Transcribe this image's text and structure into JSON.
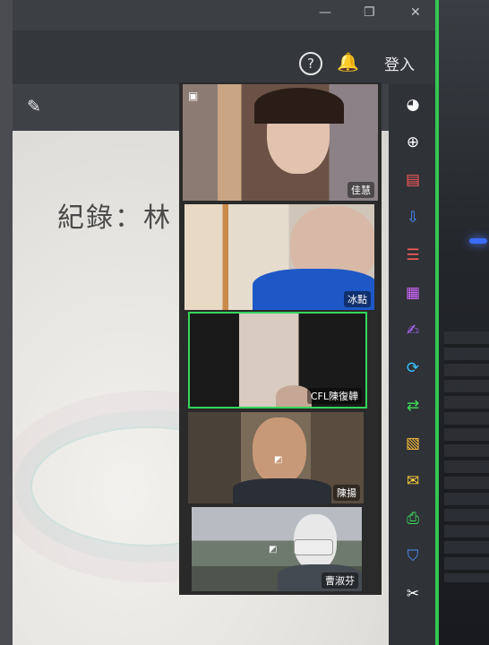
{
  "doc": {
    "title": "紀錄：林"
  },
  "header": {
    "help_icon": "?",
    "bell_icon": "🔔",
    "login_label": "登入"
  },
  "window": {
    "minimize": "—",
    "restore": "❐",
    "close": "✕"
  },
  "participants": [
    {
      "name": "佳慧",
      "mic_icon": "mic-muted-icon"
    },
    {
      "name": "冰點",
      "mic_icon": ""
    },
    {
      "name": "CFL陳復韡",
      "mic_icon": "",
      "active": true
    },
    {
      "name": "陳揚",
      "mic_icon": ""
    },
    {
      "name": "曹淑芬",
      "mic_icon": "mic-muted-icon"
    }
  ],
  "sidebar_icons": [
    {
      "name": "user-add-icon",
      "color": "#ffffff"
    },
    {
      "name": "zoom-search-icon",
      "color": "#ffffff"
    },
    {
      "name": "pdf-add-icon",
      "color": "#ff5a5a"
    },
    {
      "name": "download-doc-icon",
      "color": "#4c8dff"
    },
    {
      "name": "layout-icon",
      "color": "#ff5a5a"
    },
    {
      "name": "doc-edit-icon",
      "color": "#d267ff"
    },
    {
      "name": "sign-icon",
      "color": "#b069ff"
    },
    {
      "name": "convert-icon",
      "color": "#35c3ff"
    },
    {
      "name": "compare-icon",
      "color": "#3ee05a"
    },
    {
      "name": "export-icon",
      "color": "#ffc23a"
    },
    {
      "name": "comment-icon",
      "color": "#ffd23a"
    },
    {
      "name": "print-icon",
      "color": "#3ee05a"
    },
    {
      "name": "shield-icon",
      "color": "#4c8dff"
    },
    {
      "name": "tools-icon",
      "color": "#ffffff"
    }
  ]
}
